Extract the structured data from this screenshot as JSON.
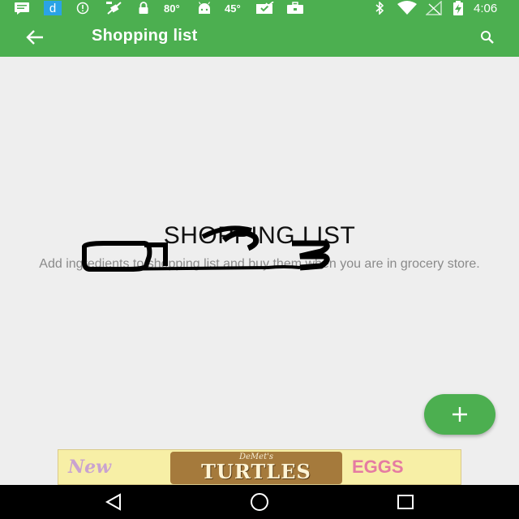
{
  "status_bar": {
    "battery_temp": "80°",
    "ambient_temp": "45°",
    "time": "4:06",
    "app_icon_letter": "d",
    "left_icons": [
      "message-icon",
      "d-app-icon",
      "info-icon",
      "no-gps-icon",
      "lock-icon",
      "android-icon",
      "photo-check-icon",
      "briefcase-icon"
    ],
    "right_icons": [
      "bluetooth-icon",
      "wifi-icon",
      "no-signal-icon",
      "battery-charging-icon"
    ]
  },
  "app_bar": {
    "title": "Shopping list",
    "back_icon": "arrow-left-icon",
    "search_icon": "search-icon",
    "color": "#4caf50"
  },
  "empty_state": {
    "title": "SHOPPING LIST",
    "description": "Add ingredients to shopping list and buy them when you are in grocery store."
  },
  "fab": {
    "icon": "plus-icon",
    "color": "#4caf50"
  },
  "ad": {
    "left_word": "New",
    "brand": "DeMet's",
    "product": "TURTLES",
    "right_word": "EGGS"
  },
  "nav_bar": {
    "icons": [
      "back-triangle-icon",
      "home-circle-icon",
      "recents-square-icon"
    ]
  }
}
